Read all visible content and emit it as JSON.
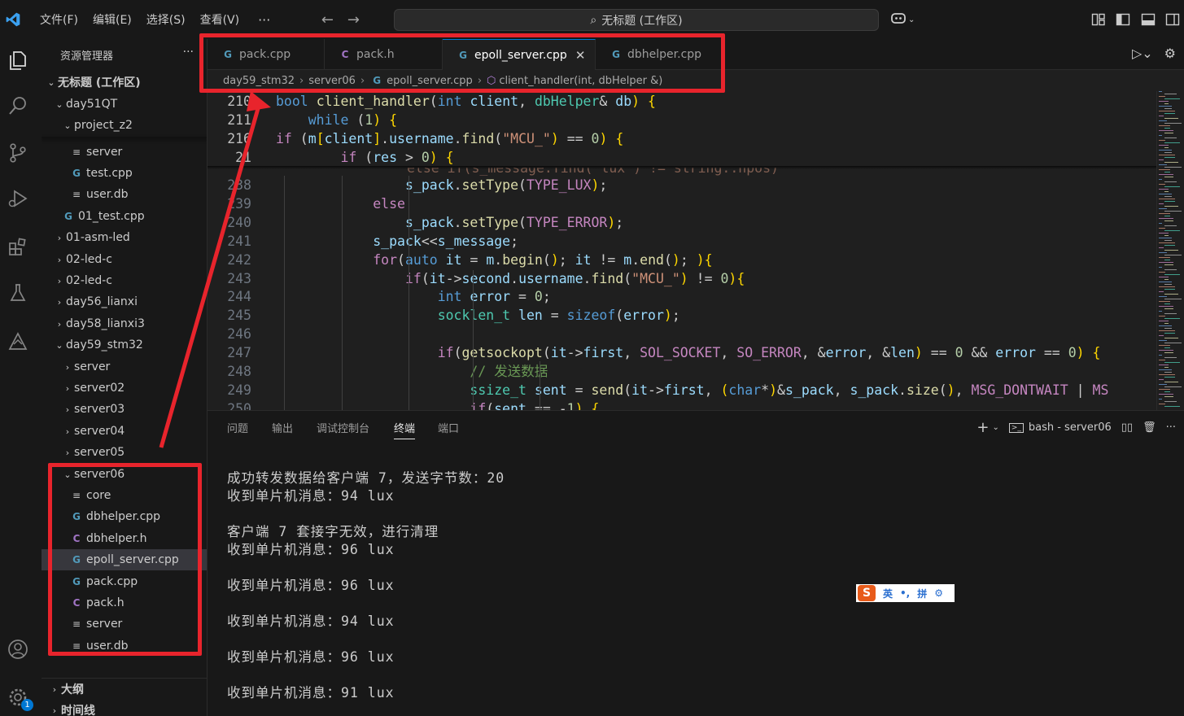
{
  "titlebar": {
    "menus": [
      "文件(F)",
      "编辑(E)",
      "选择(S)",
      "查看(V)"
    ],
    "more": "···",
    "command_center": "无标题 (工作区)"
  },
  "sidebar": {
    "title": "资源管理器",
    "more": "···",
    "workspace": "无标题 (工作区)",
    "tree": [
      {
        "label": "day51QT",
        "type": "folder-open"
      },
      {
        "label": "project_z2",
        "type": "folder-open"
      },
      {
        "label": "server",
        "type": "file"
      },
      {
        "label": "test.cpp",
        "type": "cpp"
      },
      {
        "label": "user.db",
        "type": "file"
      },
      {
        "label": "01_test.cpp",
        "type": "cpp"
      },
      {
        "label": "01-asm-led",
        "type": "folder"
      },
      {
        "label": "02-led-c",
        "type": "folder"
      },
      {
        "label": "02-led-c",
        "type": "folder"
      },
      {
        "label": "day56_lianxi",
        "type": "folder"
      },
      {
        "label": "day58_lianxi3",
        "type": "folder"
      },
      {
        "label": "day59_stm32",
        "type": "folder-open"
      },
      {
        "label": "server",
        "type": "folder"
      },
      {
        "label": "server02",
        "type": "folder"
      },
      {
        "label": "server03",
        "type": "folder"
      },
      {
        "label": "server04",
        "type": "folder"
      },
      {
        "label": "server05",
        "type": "folder"
      },
      {
        "label": "server06",
        "type": "folder-open"
      },
      {
        "label": "core",
        "type": "file"
      },
      {
        "label": "dbhelper.cpp",
        "type": "cpp"
      },
      {
        "label": "dbhelper.h",
        "type": "h"
      },
      {
        "label": "epoll_server.cpp",
        "type": "cpp"
      },
      {
        "label": "pack.cpp",
        "type": "cpp"
      },
      {
        "label": "pack.h",
        "type": "h"
      },
      {
        "label": "server",
        "type": "file"
      },
      {
        "label": "user.db",
        "type": "file"
      }
    ],
    "outline": "大纲",
    "timeline": "时间线"
  },
  "tabs": [
    {
      "label": "pack.cpp",
      "type": "cpp"
    },
    {
      "label": "pack.h",
      "type": "h"
    },
    {
      "label": "epoll_server.cpp",
      "type": "cpp",
      "active": true
    },
    {
      "label": "dbhelper.cpp",
      "type": "cpp"
    }
  ],
  "breadcrumb": [
    "day59_stm32",
    "server06",
    "epoll_server.cpp",
    "client_handler(int, dbHelper &)"
  ],
  "code": {
    "sticky": [
      {
        "n": "210",
        "text": "bool client_handler(int client, dbHelper& db) {"
      },
      {
        "n": "211",
        "text": "    while (1) {"
      },
      {
        "n": "216",
        "text": "if (m[client].username.find(\"MCU_\") == 0) {"
      },
      {
        "n": "21",
        "text": "        if (res > 0) {"
      }
    ],
    "lines": [
      {
        "n": "238",
        "text": "                s_pack.setType(TYPE_LUX);"
      },
      {
        "n": "239",
        "text": "            else"
      },
      {
        "n": "240",
        "text": "                s_pack.setType(TYPE_ERROR);"
      },
      {
        "n": "241",
        "text": "            s_pack<<s_message;"
      },
      {
        "n": "242",
        "text": "            for(auto it = m.begin(); it != m.end(); ){"
      },
      {
        "n": "243",
        "text": "                if(it->second.username.find(\"MCU_\") != 0){"
      },
      {
        "n": "244",
        "text": "                    int error = 0;"
      },
      {
        "n": "245",
        "text": "                    socklen_t len = sizeof(error);"
      },
      {
        "n": "246",
        "text": ""
      },
      {
        "n": "247",
        "text": "                    if(getsockopt(it->first, SOL_SOCKET, SO_ERROR, &error, &len) == 0 && error == 0) {"
      },
      {
        "n": "248",
        "text": "                        // 发送数据"
      },
      {
        "n": "249",
        "text": "                        ssize_t sent = send(it->first, (char*)&s_pack, s_pack.size(), MSG_DONTWAIT | MS"
      },
      {
        "n": "250",
        "text": "                        if(sent == -1) {"
      }
    ]
  },
  "panel": {
    "tabs": [
      "问题",
      "输出",
      "调试控制台",
      "终端",
      "端口"
    ],
    "active_tab": "终端",
    "terminal_name": "bash - server06",
    "terminal_lines": [
      "成功转发数据给客户端 7，发送字节数：20",
      "收到单片机消息：94 lux",
      "",
      "客户端 7 套接字无效，进行清理",
      "收到单片机消息：96 lux",
      "",
      "收到单片机消息：96 lux",
      "",
      "收到单片机消息：94 lux",
      "",
      "收到单片机消息：96 lux",
      "",
      "收到单片机消息：91 lux"
    ]
  },
  "ime": {
    "mode": "英",
    "punct": "•,",
    "pinyin": "拼"
  },
  "activity": {
    "settings_badge": "1"
  },
  "colors": {
    "accent": "#0078d4",
    "annotation": "#e8242c"
  }
}
